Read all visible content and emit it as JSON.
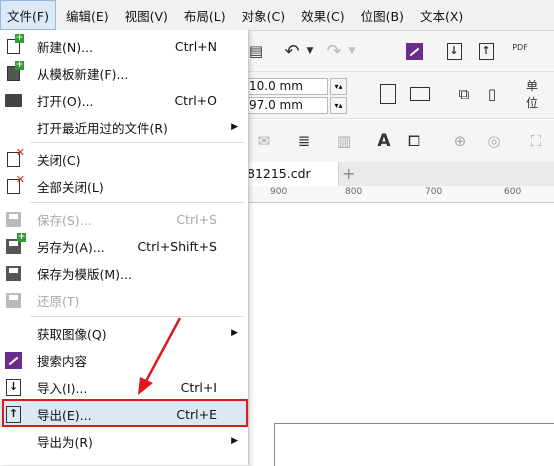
{
  "menubar": {
    "items": [
      {
        "label": "文件(F)"
      },
      {
        "label": "编辑(E)"
      },
      {
        "label": "视图(V)"
      },
      {
        "label": "布局(L)"
      },
      {
        "label": "对象(C)"
      },
      {
        "label": "效果(C)"
      },
      {
        "label": "位图(B)"
      },
      {
        "label": "文本(X)"
      }
    ]
  },
  "toolbar": {
    "width_value": "10.0 mm",
    "height_value": "97.0 mm",
    "unit_label": "单位",
    "pdf_label": "PDF"
  },
  "document": {
    "tab_label": "81215.cdr",
    "ruler_ticks": [
      "900",
      "800",
      "700",
      "600"
    ]
  },
  "file_menu": {
    "items": [
      {
        "label": "新建(N)...",
        "shortcut": "Ctrl+N",
        "icon": "new-document-icon"
      },
      {
        "label": "从模板新建(F)...",
        "shortcut": "",
        "icon": "new-from-template-icon"
      },
      {
        "label": "打开(O)...",
        "shortcut": "Ctrl+O",
        "icon": "open-folder-icon"
      },
      {
        "label": "打开最近用过的文件(R)",
        "shortcut": "",
        "icon": ""
      },
      {
        "label": "关闭(C)",
        "shortcut": "",
        "icon": "close-document-icon"
      },
      {
        "label": "全部关闭(L)",
        "shortcut": "",
        "icon": "close-all-icon"
      },
      {
        "label": "保存(S)...",
        "shortcut": "Ctrl+S",
        "icon": "save-icon"
      },
      {
        "label": "另存为(A)...",
        "shortcut": "Ctrl+Shift+S",
        "icon": "save-as-icon"
      },
      {
        "label": "保存为模版(M)...",
        "shortcut": "",
        "icon": "save-as-template-icon"
      },
      {
        "label": "还原(T)",
        "shortcut": "",
        "icon": "revert-icon"
      },
      {
        "label": "获取图像(Q)",
        "shortcut": "",
        "icon": ""
      },
      {
        "label": "搜索内容",
        "shortcut": "",
        "icon": "search-content-icon"
      },
      {
        "label": "导入(I)...",
        "shortcut": "Ctrl+I",
        "icon": "import-icon"
      },
      {
        "label": "导出(E)...",
        "shortcut": "Ctrl+E",
        "icon": "export-icon"
      },
      {
        "label": "导出为(R)",
        "shortcut": "",
        "icon": ""
      }
    ]
  },
  "colors": {
    "highlight": "#dde8f5",
    "annotation_red": "#e0191c"
  }
}
